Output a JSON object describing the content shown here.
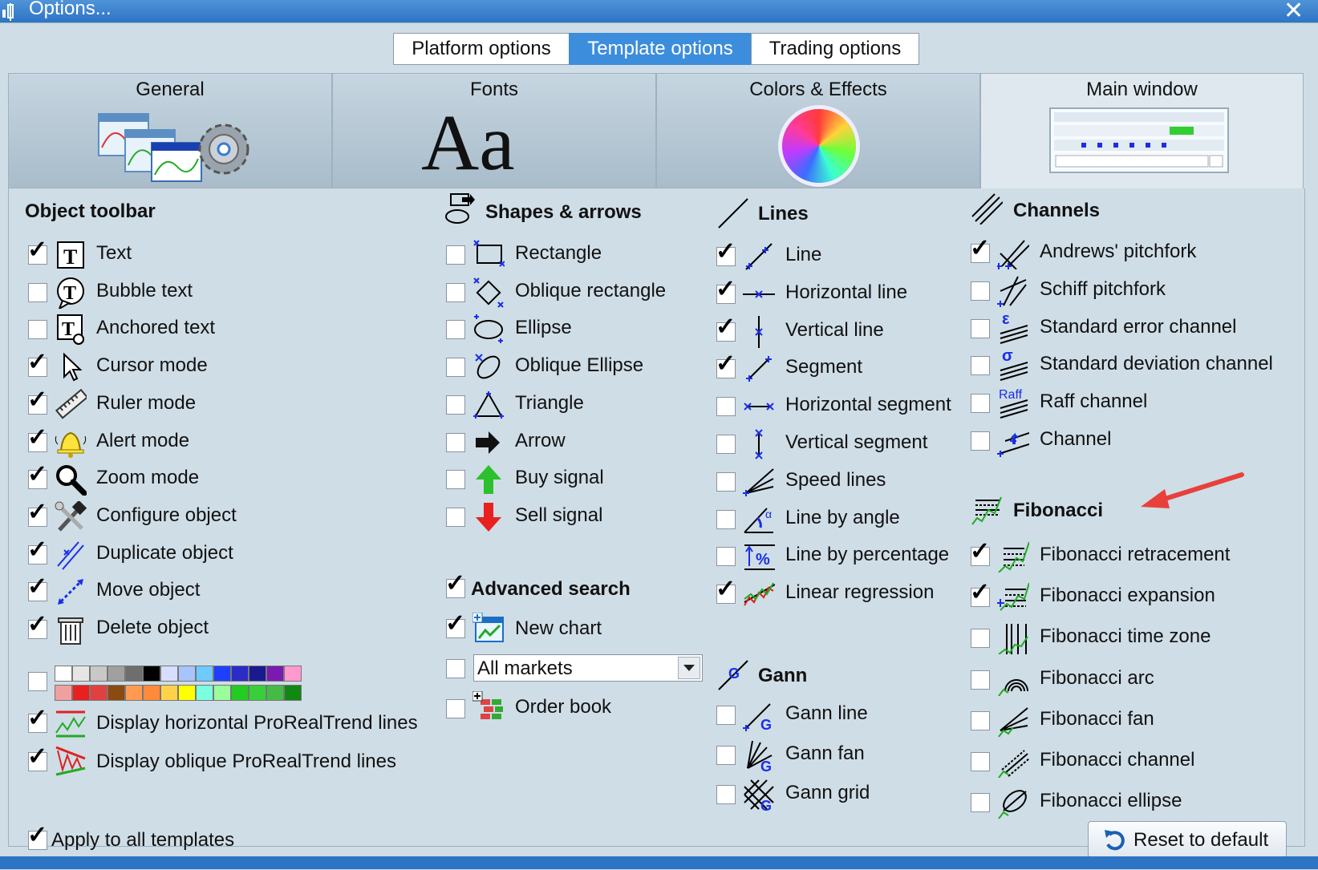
{
  "window": {
    "title": "Options...",
    "close": "✕"
  },
  "top_tabs": [
    {
      "label": "Platform options",
      "active": false
    },
    {
      "label": "Template options",
      "active": true
    },
    {
      "label": "Trading options",
      "active": false
    }
  ],
  "cards": [
    {
      "label": "General",
      "active": false
    },
    {
      "label": "Fonts",
      "active": false,
      "icon_text": "Aa"
    },
    {
      "label": "Colors & Effects",
      "active": false
    },
    {
      "label": "Main window",
      "active": true
    }
  ],
  "object_toolbar": {
    "header": "Object toolbar",
    "items": [
      {
        "label": "Text",
        "checked": true,
        "icon": "text-icon"
      },
      {
        "label": "Bubble text",
        "checked": false,
        "icon": "bubble-text-icon"
      },
      {
        "label": "Anchored text",
        "checked": false,
        "icon": "anchored-text-icon"
      },
      {
        "label": "Cursor mode",
        "checked": true,
        "icon": "cursor-icon"
      },
      {
        "label": "Ruler mode",
        "checked": true,
        "icon": "ruler-icon"
      },
      {
        "label": "Alert mode",
        "checked": true,
        "icon": "bell-icon"
      },
      {
        "label": "Zoom mode",
        "checked": true,
        "icon": "magnifier-icon"
      },
      {
        "label": "Configure object",
        "checked": true,
        "icon": "tools-icon"
      },
      {
        "label": "Duplicate object",
        "checked": true,
        "icon": "duplicate-icon"
      },
      {
        "label": "Move object",
        "checked": true,
        "icon": "move-icon"
      },
      {
        "label": "Delete object",
        "checked": true,
        "icon": "trash-icon"
      }
    ],
    "palette_checked": false,
    "palette_row1": [
      "#ffffff",
      "#e6e6e6",
      "#c8c8c8",
      "#a0a0a0",
      "#6e6e6e",
      "#000000",
      "#d8deff",
      "#a8c4ff",
      "#6ecbff",
      "#1f3fff",
      "#2b2bc8",
      "#1a1a90",
      "#7a1ab0",
      "#ff9ad0"
    ],
    "palette_row2": [
      "#f0a0a0",
      "#e82020",
      "#e04040",
      "#8a4a10",
      "#ff9a50",
      "#ff8a3a",
      "#ffd24a",
      "#ffff00",
      "#7affe0",
      "#9aff9a",
      "#22cc22",
      "#38d038",
      "#44bb44",
      "#118811"
    ],
    "extra": [
      {
        "label": "Display horizontal ProRealTrend lines",
        "checked": true,
        "icon": "prorealtrend-horizontal-icon"
      },
      {
        "label": "Display oblique ProRealTrend lines",
        "checked": true,
        "icon": "prorealtrend-oblique-icon"
      }
    ],
    "apply_all": {
      "label": "Apply to all templates",
      "checked": true
    }
  },
  "shapes": {
    "header": "Shapes & arrows",
    "items": [
      {
        "label": "Rectangle",
        "checked": false,
        "icon": "rectangle-icon"
      },
      {
        "label": "Oblique rectangle",
        "checked": false,
        "icon": "oblique-rectangle-icon"
      },
      {
        "label": "Ellipse",
        "checked": false,
        "icon": "ellipse-icon"
      },
      {
        "label": "Oblique Ellipse",
        "checked": false,
        "icon": "oblique-ellipse-icon"
      },
      {
        "label": "Triangle",
        "checked": false,
        "icon": "triangle-icon"
      },
      {
        "label": "Arrow",
        "checked": false,
        "icon": "arrow-icon"
      },
      {
        "label": "Buy signal",
        "checked": false,
        "icon": "buy-signal-icon"
      },
      {
        "label": "Sell signal",
        "checked": false,
        "icon": "sell-signal-icon"
      }
    ]
  },
  "advanced": {
    "header": "Advanced search",
    "header_checked": true,
    "new_chart": {
      "label": "New chart",
      "checked": true
    },
    "markets": {
      "checked": false,
      "value": "All markets"
    },
    "order_book": {
      "label": "Order book",
      "checked": false
    }
  },
  "lines": {
    "header": "Lines",
    "items": [
      {
        "label": "Line",
        "checked": true
      },
      {
        "label": "Horizontal line",
        "checked": true
      },
      {
        "label": "Vertical line",
        "checked": true
      },
      {
        "label": "Segment",
        "checked": true
      },
      {
        "label": "Horizontal segment",
        "checked": false
      },
      {
        "label": "Vertical segment",
        "checked": false
      },
      {
        "label": "Speed lines",
        "checked": false
      },
      {
        "label": "Line by angle",
        "checked": false
      },
      {
        "label": "Line by percentage",
        "checked": false
      },
      {
        "label": "Linear regression",
        "checked": true
      }
    ]
  },
  "gann": {
    "header": "Gann",
    "items": [
      {
        "label": "Gann line",
        "checked": false
      },
      {
        "label": "Gann fan",
        "checked": false
      },
      {
        "label": "Gann grid",
        "checked": false
      }
    ]
  },
  "channels": {
    "header": "Channels",
    "items": [
      {
        "label": "Andrews' pitchfork",
        "checked": true
      },
      {
        "label": "Schiff pitchfork",
        "checked": false
      },
      {
        "label": "Standard error channel",
        "checked": false,
        "glyph": "ε"
      },
      {
        "label": "Standard deviation channel",
        "checked": false,
        "glyph": "σ"
      },
      {
        "label": "Raff channel",
        "checked": false,
        "glyph": "Raff"
      },
      {
        "label": "Channel",
        "checked": false
      }
    ]
  },
  "fibonacci": {
    "header": "Fibonacci",
    "items": [
      {
        "label": "Fibonacci retracement",
        "checked": true
      },
      {
        "label": "Fibonacci expansion",
        "checked": true
      },
      {
        "label": "Fibonacci time zone",
        "checked": false
      },
      {
        "label": "Fibonacci arc",
        "checked": false
      },
      {
        "label": "Fibonacci fan",
        "checked": false
      },
      {
        "label": "Fibonacci channel",
        "checked": false
      },
      {
        "label": "Fibonacci ellipse",
        "checked": false
      }
    ]
  },
  "reset": {
    "label": "Reset to default"
  },
  "colors": {
    "accent": "#3c8ddc",
    "title_bar": "#2d74c4",
    "annotation_arrow": "#e8403a",
    "icon_blue": "#1a2ee8"
  }
}
